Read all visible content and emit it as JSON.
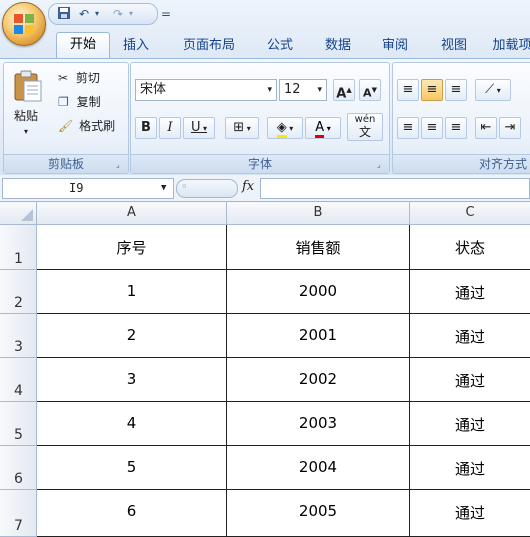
{
  "quick_access": {
    "redo_arrow": "▾",
    "customize": "="
  },
  "tabs": [
    "开始",
    "插入",
    "页面布局",
    "公式",
    "数据",
    "审阅",
    "视图",
    "加载项"
  ],
  "active_tab": "开始",
  "clipboard": {
    "paste": "粘贴",
    "cut": "剪切",
    "copy": "复制",
    "format_painter": "格式刷",
    "label": "剪贴板"
  },
  "font": {
    "name": "宋体",
    "size": "12",
    "bold": "B",
    "italic": "I",
    "underline": "U",
    "grow": "A",
    "shrink": "A",
    "wen": "wén",
    "wen_char": "文",
    "label": "字体"
  },
  "alignment": {
    "label": "对齐方式"
  },
  "formula_bar": {
    "name_box": "I9",
    "fx": "fx",
    "value": ""
  },
  "columns": [
    "A",
    "B",
    "C"
  ],
  "rows": [
    {
      "num": "1",
      "cells": [
        "序号",
        "销售额",
        "状态"
      ]
    },
    {
      "num": "2",
      "cells": [
        "1",
        "2000",
        "通过"
      ]
    },
    {
      "num": "3",
      "cells": [
        "2",
        "2001",
        "通过"
      ]
    },
    {
      "num": "4",
      "cells": [
        "3",
        "2002",
        "通过"
      ]
    },
    {
      "num": "5",
      "cells": [
        "4",
        "2003",
        "通过"
      ]
    },
    {
      "num": "6",
      "cells": [
        "5",
        "2004",
        "通过"
      ]
    },
    {
      "num": "7",
      "cells": [
        "6",
        "2005",
        "通过"
      ]
    }
  ]
}
